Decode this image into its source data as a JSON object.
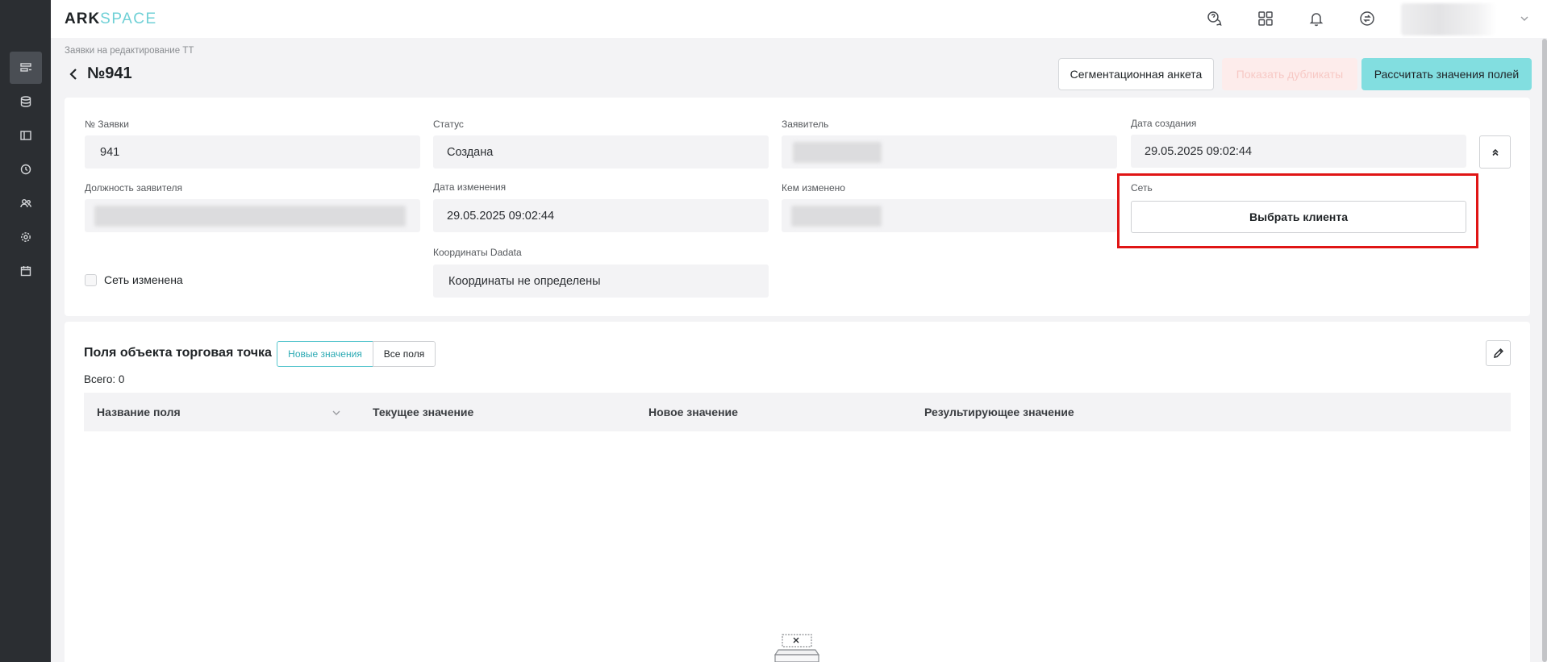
{
  "app": {
    "logo_ark": "ARK",
    "logo_space": "SPACE"
  },
  "header_icons": [
    "help-chat-icon",
    "apps-grid-icon",
    "bell-icon",
    "sync-icon"
  ],
  "sidebar_icons": [
    "requests-icon",
    "database-icon",
    "layout-icon",
    "clock-icon",
    "users-icon",
    "settings-icon",
    "calendar-icon"
  ],
  "page": {
    "breadcrumb": "Заявки на редактирование ТТ",
    "title": "№941"
  },
  "actions": {
    "segmentation": "Сегментационная анкета",
    "show_duplicates": "Показать дубликаты",
    "calculate": "Рассчитать значения полей"
  },
  "form": {
    "request_no_label": "№ Заявки",
    "request_no_value": "941",
    "status_label": "Статус",
    "status_value": "Создана",
    "applicant_label": "Заявитель",
    "created_label": "Дата создания",
    "created_value": "29.05.2025 09:02:44",
    "position_label": "Должность заявителя",
    "modified_label": "Дата изменения",
    "modified_value": "29.05.2025 09:02:44",
    "modified_by_label": "Кем изменено",
    "network_label": "Сеть",
    "choose_client": "Выбрать клиента",
    "coords_label": "Координаты Dadata",
    "coords_value": "Координаты не определены",
    "network_changed": "Сеть изменена"
  },
  "fields_section": {
    "title": "Поля объекта торговая точка",
    "tab_new": "Новые значения",
    "tab_all": "Все поля",
    "total": "Всего: 0",
    "columns": [
      "Название поля",
      "Текущее значение",
      "Новое значение",
      "Результирующее значение"
    ]
  }
}
